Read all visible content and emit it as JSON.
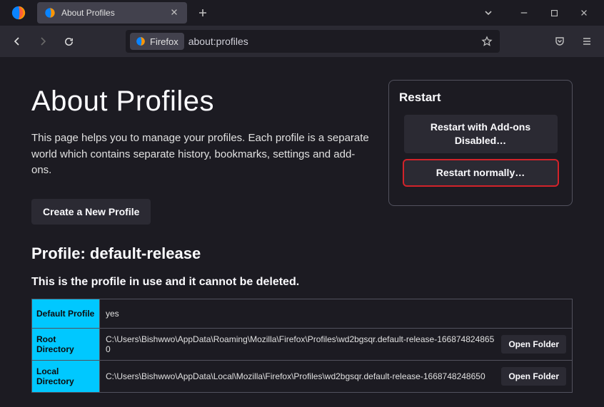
{
  "window": {
    "tab_title": "About Profiles"
  },
  "urlbar": {
    "chip_label": "Firefox",
    "url": "about:profiles"
  },
  "page": {
    "title": "About Profiles",
    "description": "This page helps you to manage your profiles. Each profile is a separate world which contains separate history, bookmarks, settings and add-ons.",
    "create_button": "Create a New Profile"
  },
  "restart": {
    "heading": "Restart",
    "addons_disabled": "Restart with Add-ons Disabled…",
    "normally": "Restart normally…"
  },
  "profile": {
    "heading": "Profile: default-release",
    "note": "This is the profile in use and it cannot be deleted.",
    "rows": [
      {
        "key": "Default Profile",
        "value": "yes",
        "open_folder": false
      },
      {
        "key": "Root Directory",
        "value": "C:\\Users\\Bishwwo\\AppData\\Roaming\\Mozilla\\Firefox\\Profiles\\wd2bgsqr.default-release-1668748248650",
        "open_folder": true
      },
      {
        "key": "Local Directory",
        "value": "C:\\Users\\Bishwwo\\AppData\\Local\\Mozilla\\Firefox\\Profiles\\wd2bgsqr.default-release-1668748248650",
        "open_folder": true
      }
    ],
    "open_folder_label": "Open Folder"
  }
}
